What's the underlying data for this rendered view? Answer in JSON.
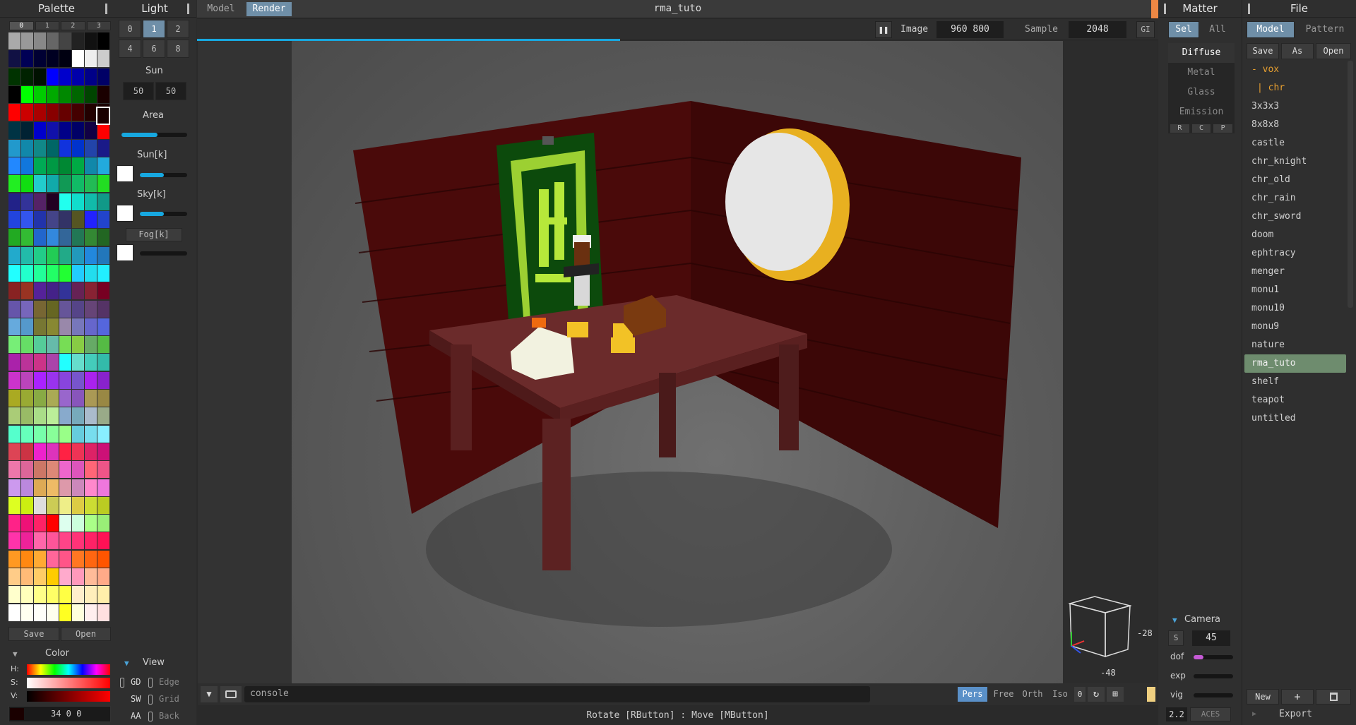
{
  "palette": {
    "title": "Palette",
    "tabs": [
      "0",
      "1",
      "2",
      "3"
    ],
    "active_tab": "0",
    "save": "Save",
    "open": "Open",
    "colors": [
      [
        "#aaaaaa",
        "#999999",
        "#888888",
        "#666666",
        "#444444",
        "#222222",
        "#111111",
        "#000000"
      ],
      [
        "#111144",
        "#000055",
        "#000033",
        "#000022",
        "#000011",
        "#ffffff",
        "#eeeeee",
        "#cccccc"
      ],
      [
        "#003300",
        "#002200",
        "#001100",
        "#0000ff",
        "#0000cc",
        "#0000aa",
        "#000088",
        "#000066"
      ],
      [
        "#000000",
        "#00ff00",
        "#00cc00",
        "#00aa00",
        "#008800",
        "#006600",
        "#004400",
        "#1a0000"
      ],
      [
        "#ff0000",
        "#cc0000",
        "#aa0000",
        "#880000",
        "#660000",
        "#440000",
        "#220000",
        "#1a0000"
      ],
      [
        "#003344",
        "#002233",
        "#0000cc",
        "#1111aa",
        "#000088",
        "#000066",
        "#110044",
        "#ff0000"
      ],
      [
        "#2299cc",
        "#1188aa",
        "#118888",
        "#006666",
        "#1133dd",
        "#0033cc",
        "#2244aa",
        "#1a1a88"
      ],
      [
        "#2288ff",
        "#1177dd",
        "#00aa55",
        "#009944",
        "#008833",
        "#00aa44",
        "#1188aa",
        "#22aadd"
      ],
      [
        "#22ee22",
        "#11dd11",
        "#22cccc",
        "#11aaaa",
        "#119955",
        "#11bb66",
        "#22bb55",
        "#22dd22"
      ],
      [
        "#222288",
        "#333399",
        "#552266",
        "#220022",
        "#22ffee",
        "#11ddcc",
        "#11bbaa",
        "#119988"
      ],
      [
        "#2244dd",
        "#3355ee",
        "#2233aa",
        "#444488",
        "#333366",
        "#555522",
        "#2222ff",
        "#2244cc"
      ],
      [
        "#22aa22",
        "#33bb33",
        "#2266cc",
        "#3388dd",
        "#336699",
        "#227755",
        "#338833",
        "#226622"
      ],
      [
        "#22aacc",
        "#22bbaa",
        "#22cc88",
        "#22cc55",
        "#22aa88",
        "#2299bb",
        "#2288dd",
        "#2277bb"
      ],
      [
        "#22ffff",
        "#22ffcc",
        "#22ff99",
        "#22ff66",
        "#22ff33",
        "#22ccff",
        "#22ddee",
        "#22eeff"
      ],
      [
        "#882222",
        "#993322",
        "#552299",
        "#442288",
        "#333399",
        "#662255",
        "#882233",
        "#770022"
      ],
      [
        "#6655aa",
        "#7766bb",
        "#776633",
        "#666622",
        "#665599",
        "#554488",
        "#664477",
        "#553366"
      ],
      [
        "#66aadd",
        "#5599cc",
        "#777733",
        "#888833",
        "#9988aa",
        "#7777bb",
        "#6666cc",
        "#5566dd"
      ],
      [
        "#77ee77",
        "#66dd66",
        "#55cc99",
        "#66bbaa",
        "#77dd55",
        "#88cc44",
        "#66aa66",
        "#55bb44"
      ],
      [
        "#aa22aa",
        "#bb3399",
        "#cc3388",
        "#aa44aa",
        "#22ffff",
        "#66ddcc",
        "#44ccbb",
        "#33bbaa"
      ],
      [
        "#cc33cc",
        "#bb44bb",
        "#aa22ff",
        "#9933ee",
        "#8844dd",
        "#7755cc",
        "#aa22ee",
        "#8822cc"
      ],
      [
        "#aaaa22",
        "#99aa33",
        "#88aa44",
        "#aaaa55",
        "#9966cc",
        "#8855bb",
        "#aa9955",
        "#998844"
      ],
      [
        "#aacc77",
        "#99bb66",
        "#aadd88",
        "#bbee99",
        "#88aacc",
        "#77aabb",
        "#aabbcc",
        "#99aa88"
      ],
      [
        "#55ffcc",
        "#66ffbb",
        "#77ffaa",
        "#88ff99",
        "#99ff88",
        "#66ccdd",
        "#77ddee",
        "#88eeff"
      ],
      [
        "#dd4455",
        "#cc3344",
        "#ee22cc",
        "#dd33bb",
        "#ff2244",
        "#ee3355",
        "#dd2266",
        "#cc1177"
      ],
      [
        "#ee77aa",
        "#dd6699",
        "#cc7766",
        "#dd8877",
        "#ee66cc",
        "#dd55bb",
        "#ff6677",
        "#ee5588"
      ],
      [
        "#cc99ee",
        "#bb88dd",
        "#ddaa55",
        "#eebb66",
        "#dd99aa",
        "#cc88bb",
        "#ff88cc",
        "#ee77dd"
      ],
      [
        "#ddff22",
        "#ccee11",
        "#dddddd",
        "#cccc55",
        "#eeee88",
        "#ddcc44",
        "#ccdd33",
        "#bbcc22"
      ],
      [
        "#ff2288",
        "#ee1177",
        "#ff2266",
        "#ff0000",
        "#ddffee",
        "#ccffdd",
        "#aaff88",
        "#99ee77"
      ],
      [
        "#ff33aa",
        "#ee2299",
        "#ff66aa",
        "#ff5599",
        "#ff4488",
        "#ff3377",
        "#ff2266",
        "#ff1155"
      ],
      [
        "#ff9922",
        "#ff8811",
        "#ffaa33",
        "#ff6699",
        "#ff5588",
        "#ff7722",
        "#ff6611",
        "#ff5500"
      ],
      [
        "#ffcc88",
        "#ffbb77",
        "#ffcc66",
        "#ffcc00",
        "#ffaacc",
        "#ff99bb",
        "#ffbb99",
        "#ffaa88"
      ],
      [
        "#ffffcc",
        "#ffffbb",
        "#ffff88",
        "#ffff66",
        "#ffff44",
        "#ffeecc",
        "#ffeebb",
        "#ffeeaa"
      ],
      [
        "#ffffff",
        "#fffff0",
        "#fffff8",
        "#ffffee",
        "#ffff22",
        "#ffffdd",
        "#ffeeee",
        "#ffe0e0"
      ]
    ],
    "color_section": "Color",
    "h_label": "H:",
    "s_label": "S:",
    "v_label": "V:",
    "hsv_value": "34 0 0"
  },
  "light": {
    "title": "Light",
    "tabs": [
      "0",
      "1",
      "2",
      "4",
      "6",
      "8"
    ],
    "active_tab": "1",
    "sun_label": "Sun",
    "sun_x": "50",
    "sun_y": "50",
    "area_label": "Area",
    "area_level": 0.55,
    "sunk_label": "Sun[k]",
    "sunk_level": 0.5,
    "skyk_label": "Sky[k]",
    "skyk_level": 0.5,
    "fogk_label": "Fog[k]",
    "fogk_level": 0.0,
    "view_label": "View",
    "view_rows": [
      {
        "a": "GD",
        "b": "Edge"
      },
      {
        "a": "SW",
        "b": "Grid"
      },
      {
        "a": "AA",
        "b": "Back"
      }
    ]
  },
  "topbar": {
    "model_tab": "Model",
    "render_tab": "Render",
    "title": "rma_tuto",
    "image_label": "Image",
    "image_size": "960 800",
    "sample_label": "Sample",
    "sample_value": "2048",
    "gi_label": "GI",
    "render_progress": 0.44
  },
  "bottombar": {
    "console_placeholder": "console",
    "pers": "Pers",
    "free": "Free",
    "orth": "Orth",
    "iso": "Iso",
    "zero": "0",
    "status": "Rotate [RButton] : Move [MButton]"
  },
  "gizmo": {
    "right_value": "-28",
    "bottom_value": "-48"
  },
  "matter": {
    "title": "Matter",
    "sel": "Sel",
    "all": "All",
    "materials": [
      "Diffuse",
      "Metal",
      "Glass",
      "Emission"
    ],
    "active_material": "Diffuse",
    "rcp": [
      "R",
      "C",
      "P"
    ],
    "camera_label": "Camera",
    "s_button": "S",
    "fov": "45",
    "dof_label": "dof",
    "dof_level": 0.25,
    "exp_label": "exp",
    "vig_label": "vig",
    "gamma": "2.2",
    "tonemap": "ACES"
  },
  "file": {
    "title": "File",
    "model_tab": "Model",
    "pattern_tab": "Pattern",
    "save": "Save",
    "as": "As",
    "open": "Open",
    "folder_vox": "- vox",
    "folder_chr": "| chr",
    "items": [
      "3x3x3",
      "8x8x8",
      "castle",
      "chr_knight",
      "chr_old",
      "chr_rain",
      "chr_sword",
      "doom",
      "ephtracy",
      "menger",
      "monu1",
      "monu10",
      "monu9",
      "nature",
      "rma_tuto",
      "shelf",
      "teapot",
      "untitled"
    ],
    "selected": "rma_tuto",
    "new_label": "New",
    "plus_label": "+",
    "export_label": "Export"
  }
}
